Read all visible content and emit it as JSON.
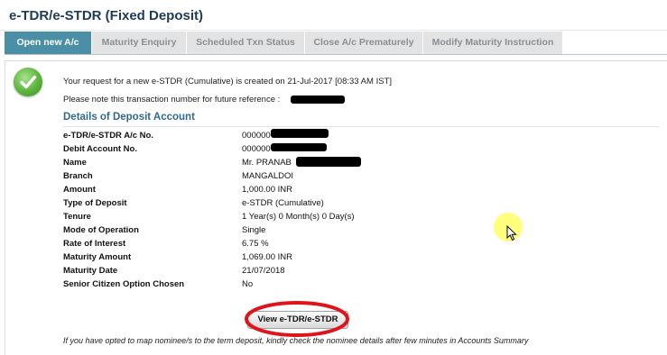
{
  "page": {
    "title": "e-TDR/e-STDR (Fixed Deposit)"
  },
  "tabs": [
    {
      "label": "Open new A/c",
      "active": true
    },
    {
      "label": "Maturity Enquiry",
      "active": false
    },
    {
      "label": "Scheduled Txn Status",
      "active": false
    },
    {
      "label": "Close A/c Prematurely",
      "active": false
    },
    {
      "label": "Modify Maturity Instruction",
      "active": false
    }
  ],
  "confirmation": {
    "message": "Your request for a new e-STDR (Cumulative) is created on 21-Jul-2017 [08:33 AM IST]",
    "reference_note": "Please note this transaction number for future reference :"
  },
  "details": {
    "heading": "Details of Deposit Account",
    "rows": [
      {
        "label": "e-TDR/e-STDR A/c No.",
        "value": "000000"
      },
      {
        "label": "Debit Account No.",
        "value": "000000"
      },
      {
        "label": "Name",
        "value": "Mr. PRANAB"
      },
      {
        "label": "Branch",
        "value": "MANGALDOI"
      },
      {
        "label": "Amount",
        "value": "1,000.00 INR"
      },
      {
        "label": "Type of Deposit",
        "value": "e-STDR (Cumulative)"
      },
      {
        "label": "Tenure",
        "value": "1 Year(s) 0 Month(s) 0 Day(s)"
      },
      {
        "label": "Mode of Operation",
        "value": "Single"
      },
      {
        "label": "Rate of Interest",
        "value": "6.75  %"
      },
      {
        "label": "Maturity Amount",
        "value": "1,069.00  INR"
      },
      {
        "label": "Maturity Date",
        "value": "21/07/2018"
      },
      {
        "label": "Senior Citizen Option Chosen",
        "value": "No"
      }
    ]
  },
  "actions": {
    "view_button": "View e-TDR/e-STDR"
  },
  "footer": {
    "nominee_note": "If you have opted to map nominee/s to the term deposit, kindly check the nominee details after few minutes in Accounts Summary"
  },
  "colors": {
    "active_tab": "#4a8fa6",
    "inactive_tab": "#e3e3e3",
    "section_heading": "#2e6a8c",
    "annotation": "#e0141b",
    "cursor_highlight": "#ffff66"
  }
}
